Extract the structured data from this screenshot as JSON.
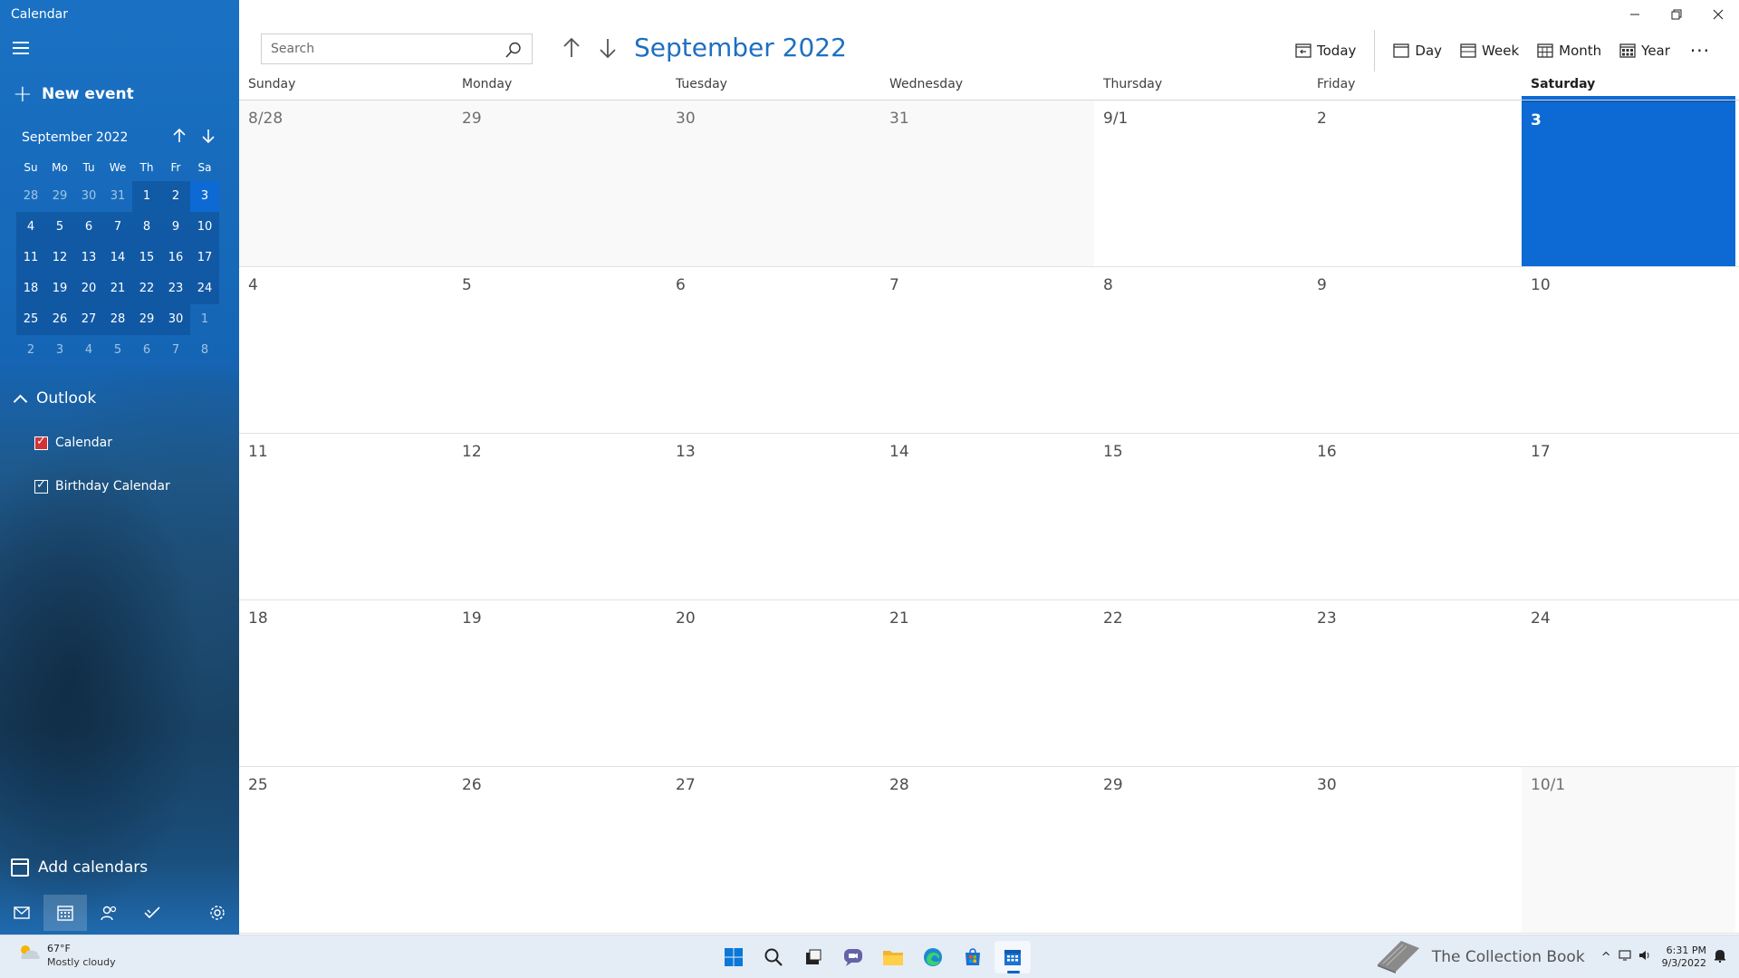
{
  "app": {
    "title": "Calendar"
  },
  "sidebar": {
    "new_event_label": "New event",
    "mini_calendar": {
      "title": "September 2022",
      "dow": [
        "Su",
        "Mo",
        "Tu",
        "We",
        "Th",
        "Fr",
        "Sa"
      ],
      "weeks": [
        [
          "28",
          "29",
          "30",
          "31",
          "1",
          "2",
          "3"
        ],
        [
          "4",
          "5",
          "6",
          "7",
          "8",
          "9",
          "10"
        ],
        [
          "11",
          "12",
          "13",
          "14",
          "15",
          "16",
          "17"
        ],
        [
          "18",
          "19",
          "20",
          "21",
          "22",
          "23",
          "24"
        ],
        [
          "25",
          "26",
          "27",
          "28",
          "29",
          "30",
          "1"
        ],
        [
          "2",
          "3",
          "4",
          "5",
          "6",
          "7",
          "8"
        ]
      ]
    },
    "account": {
      "label": "Outlook"
    },
    "calendars": [
      {
        "label": "Calendar",
        "checked": true,
        "color": "#d13438"
      },
      {
        "label": "Birthday Calendar",
        "checked": true,
        "color": "#ffffff"
      }
    ],
    "add_calendars_label": "Add calendars"
  },
  "main": {
    "search_placeholder": "Search",
    "title": "September 2022",
    "toolbar": {
      "today": "Today",
      "day": "Day",
      "week": "Week",
      "month": "Month",
      "year": "Year",
      "more": "···"
    },
    "dow": [
      "Sunday",
      "Monday",
      "Tuesday",
      "Wednesday",
      "Thursday",
      "Friday",
      "Saturday"
    ],
    "weeks": [
      [
        "8/28",
        "29",
        "30",
        "31",
        "9/1",
        "2",
        "3"
      ],
      [
        "4",
        "5",
        "6",
        "7",
        "8",
        "9",
        "10"
      ],
      [
        "11",
        "12",
        "13",
        "14",
        "15",
        "16",
        "17"
      ],
      [
        "18",
        "19",
        "20",
        "21",
        "22",
        "23",
        "24"
      ],
      [
        "25",
        "26",
        "27",
        "28",
        "29",
        "30",
        "10/1"
      ]
    ]
  },
  "taskbar": {
    "weather": {
      "temp": "67°F",
      "condition": "Mostly cloudy"
    },
    "brand": "The Collection Book",
    "time": "6:31 PM",
    "date": "9/3/2022"
  },
  "colors": {
    "accent": "#0d6ad4",
    "title": "#1f6fc1"
  }
}
